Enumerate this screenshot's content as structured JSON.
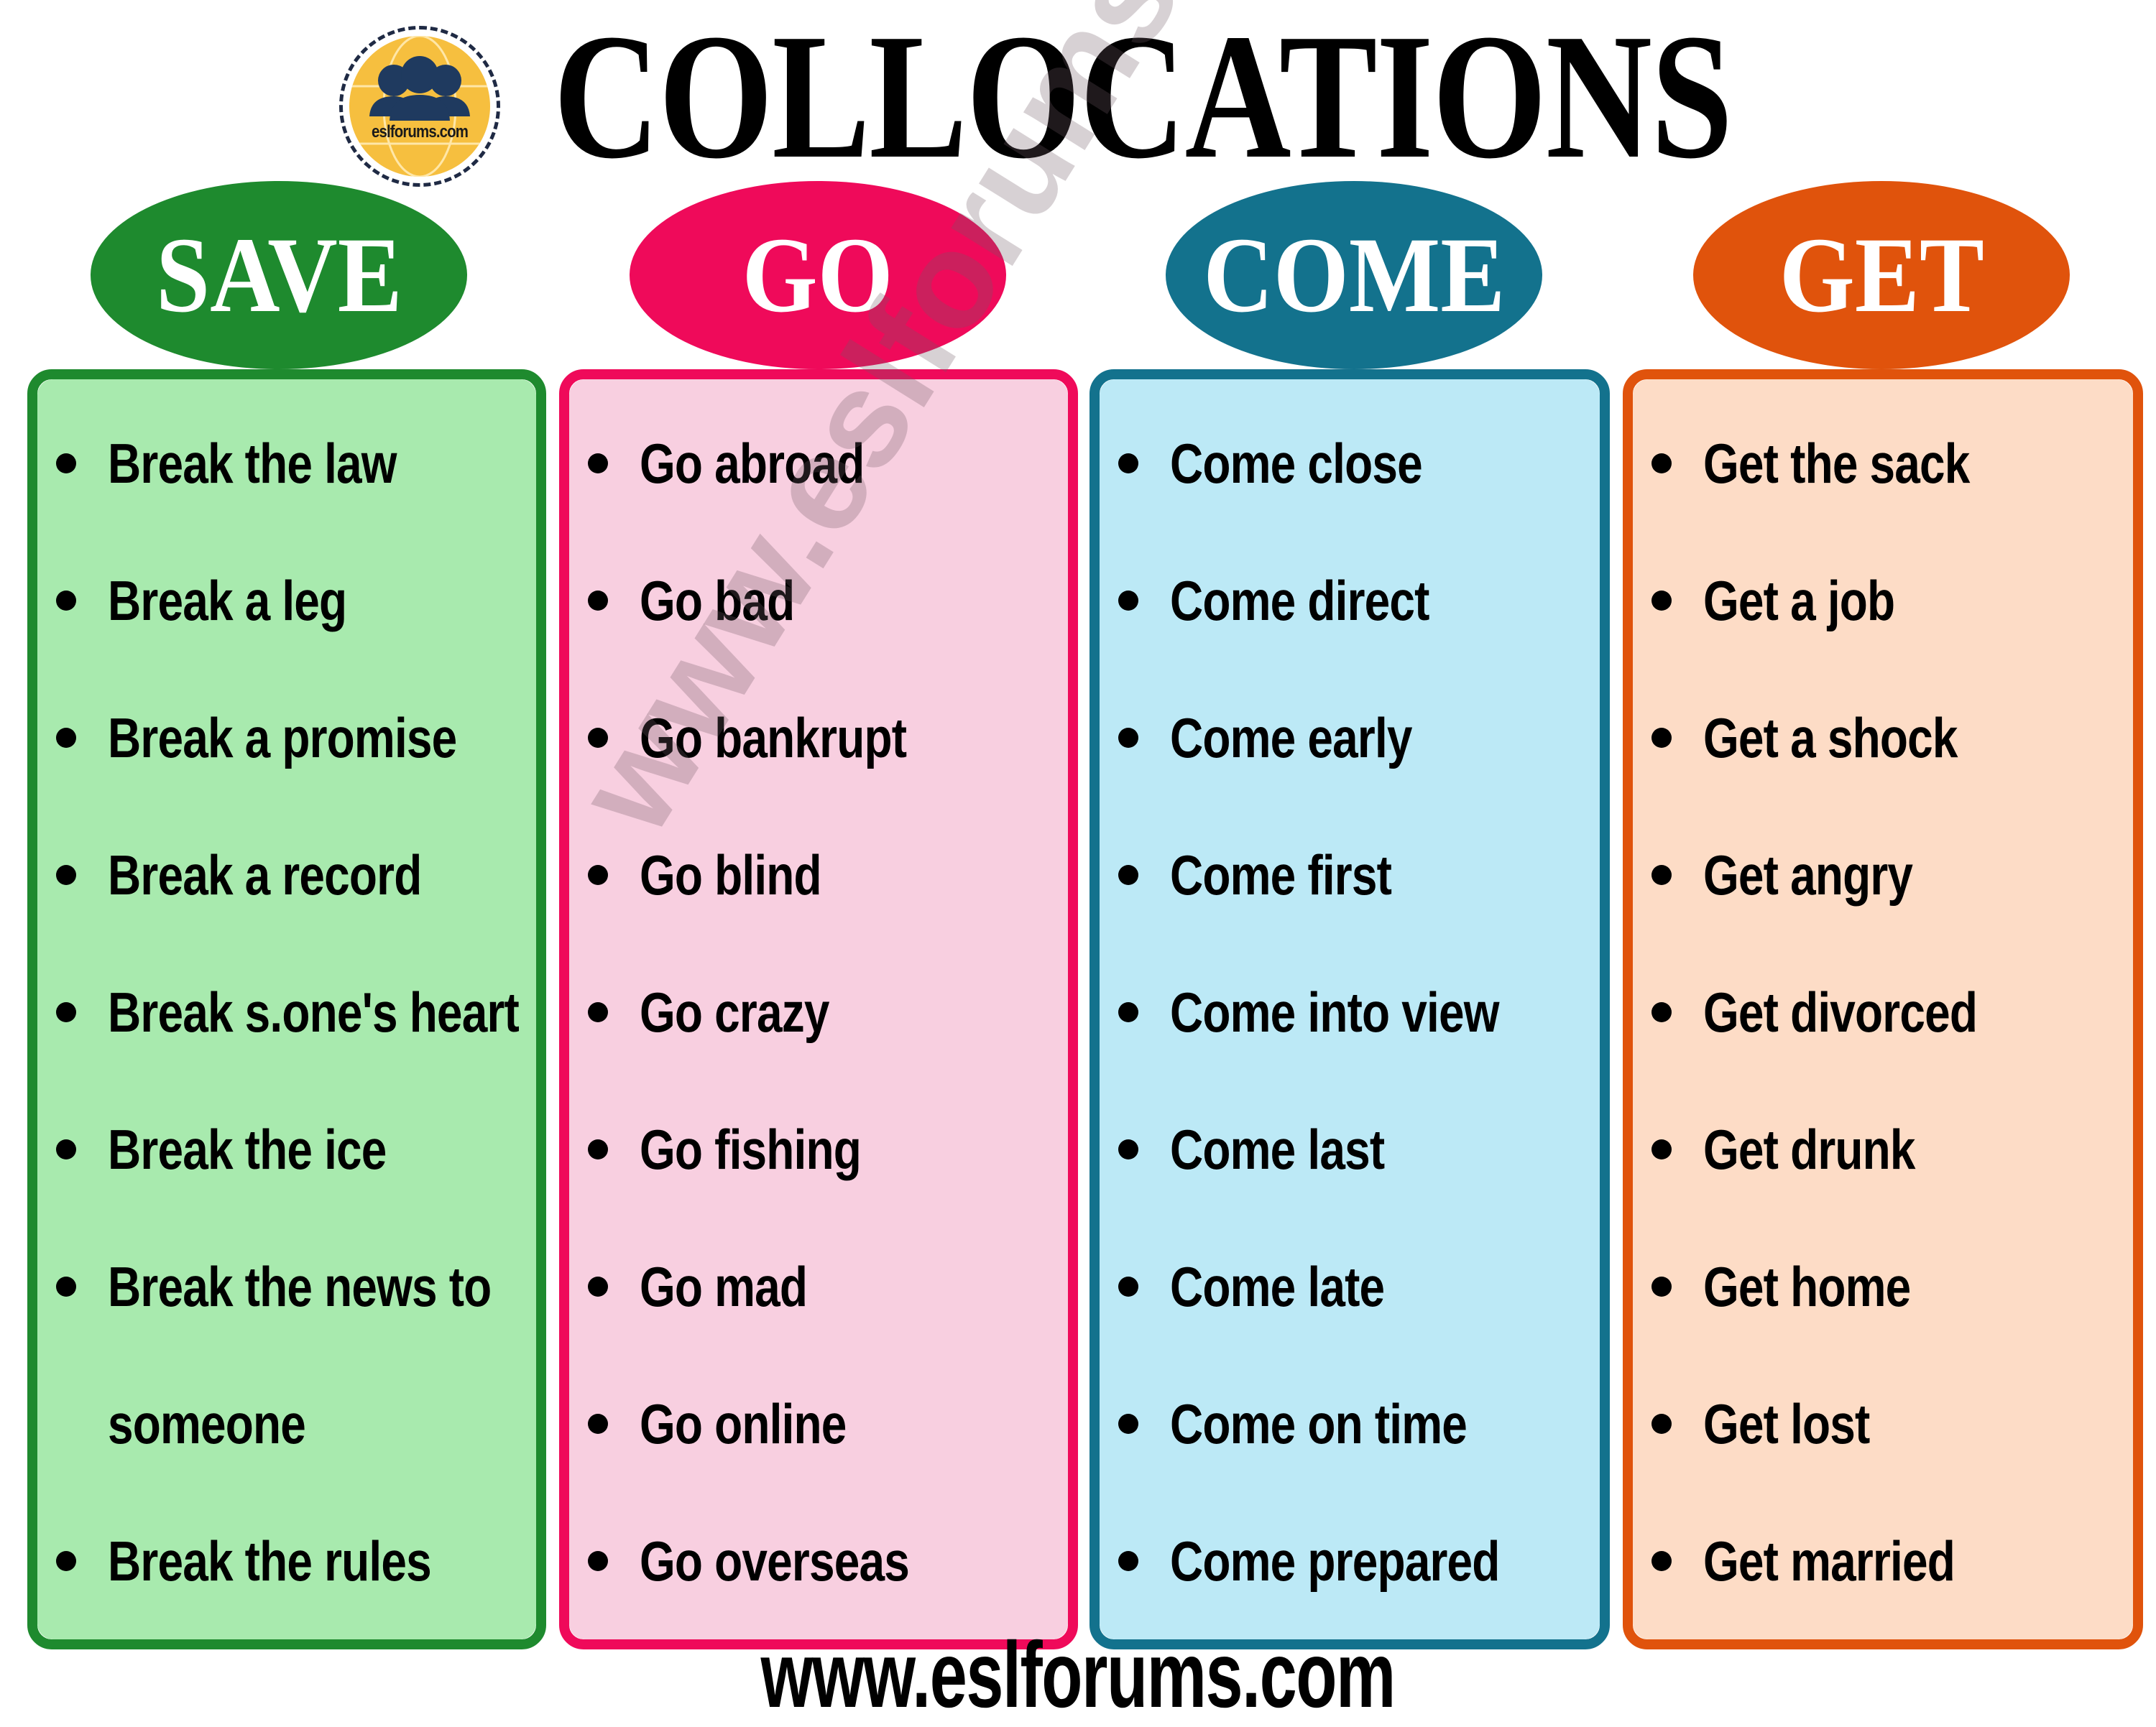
{
  "title": "COLLOCATIONS",
  "logo": {
    "icon": "people-globe-icon",
    "text": "eslforums.com",
    "colors": {
      "globe": "#f6bf3f",
      "people": "#1f3a5f"
    }
  },
  "columns": [
    {
      "heading": "SAVE",
      "accent": "#1e8a2e",
      "fill": "#a8eaae",
      "items": [
        "Break the law",
        "Break a leg",
        "Break a promise",
        "Break a record",
        "Break s.one's heart",
        "Break the ice",
        "Break the news to",
        "someone",
        "Break the rules"
      ]
    },
    {
      "heading": "GO",
      "accent": "#ef0a5a",
      "fill": "#f8cfe0",
      "items": [
        "Go abroad",
        "Go bad",
        "Go bankrupt",
        "Go blind",
        "Go crazy",
        "Go fishing",
        "Go mad",
        "Go online",
        "Go overseas"
      ]
    },
    {
      "heading": "COME",
      "accent": "#13728d",
      "fill": "#bce9f6",
      "items": [
        "Come close",
        "Come direct",
        "Come early",
        "Come first",
        "Come into view",
        "Come last",
        "Come late",
        "Come on time",
        "Come prepared"
      ]
    },
    {
      "heading": "GET",
      "accent": "#e0530c",
      "fill": "#fddcc6",
      "items": [
        "Get the sack",
        "Get a job",
        "Get a shock",
        "Get angry",
        "Get divorced",
        "Get drunk",
        "Get home",
        "Get lost",
        "Get married"
      ]
    }
  ],
  "watermark": "www.eslforums.com",
  "footer": "www.eslforums.com"
}
